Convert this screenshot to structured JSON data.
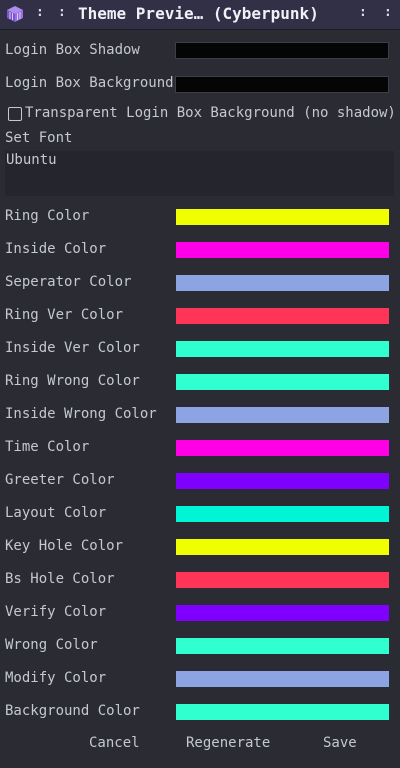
{
  "window": {
    "title": "Theme Previe… (Cyberpunk)",
    "icon": "app-cube-icon",
    "left_dots": ":",
    "right_dots": ":"
  },
  "fields": {
    "login_box_shadow_label": "Login Box Shadow",
    "login_box_shadow_color": "#050505",
    "login_box_background_label": "Login Box Background",
    "login_box_background_color": "#050505"
  },
  "transparent_checkbox": {
    "label": "Transparent Login Box Background (no shadow)",
    "checked": false
  },
  "font": {
    "label": "Set Font",
    "value": "Ubuntu"
  },
  "colors": [
    {
      "label": "Ring Color",
      "hex": "#f0ff00"
    },
    {
      "label": "Inside Color",
      "hex": "#ff00e6"
    },
    {
      "label": "Seperator Color",
      "hex": "#8da4e2"
    },
    {
      "label": "Ring Ver Color",
      "hex": "#ff3558"
    },
    {
      "label": "Inside Ver Color",
      "hex": "#30ffd0"
    },
    {
      "label": "Ring Wrong Color",
      "hex": "#30ffd0"
    },
    {
      "label": "Inside Wrong Color",
      "hex": "#8da4e2"
    },
    {
      "label": "Time Color",
      "hex": "#ff00e6"
    },
    {
      "label": "Greeter Color",
      "hex": "#7f00ff"
    },
    {
      "label": "Layout Color",
      "hex": "#00f5d4"
    },
    {
      "label": "Key Hole Color",
      "hex": "#f0ff00"
    },
    {
      "label": "Bs Hole Color",
      "hex": "#ff3558"
    },
    {
      "label": "Verify Color",
      "hex": "#7f00ff"
    },
    {
      "label": "Wrong Color",
      "hex": "#30ffd0"
    },
    {
      "label": "Modify Color",
      "hex": "#8da4e2"
    },
    {
      "label": "Background Color",
      "hex": "#30ffd0"
    }
  ],
  "buttons": {
    "cancel": "Cancel",
    "regenerate": "Regenerate",
    "save": "Save"
  }
}
